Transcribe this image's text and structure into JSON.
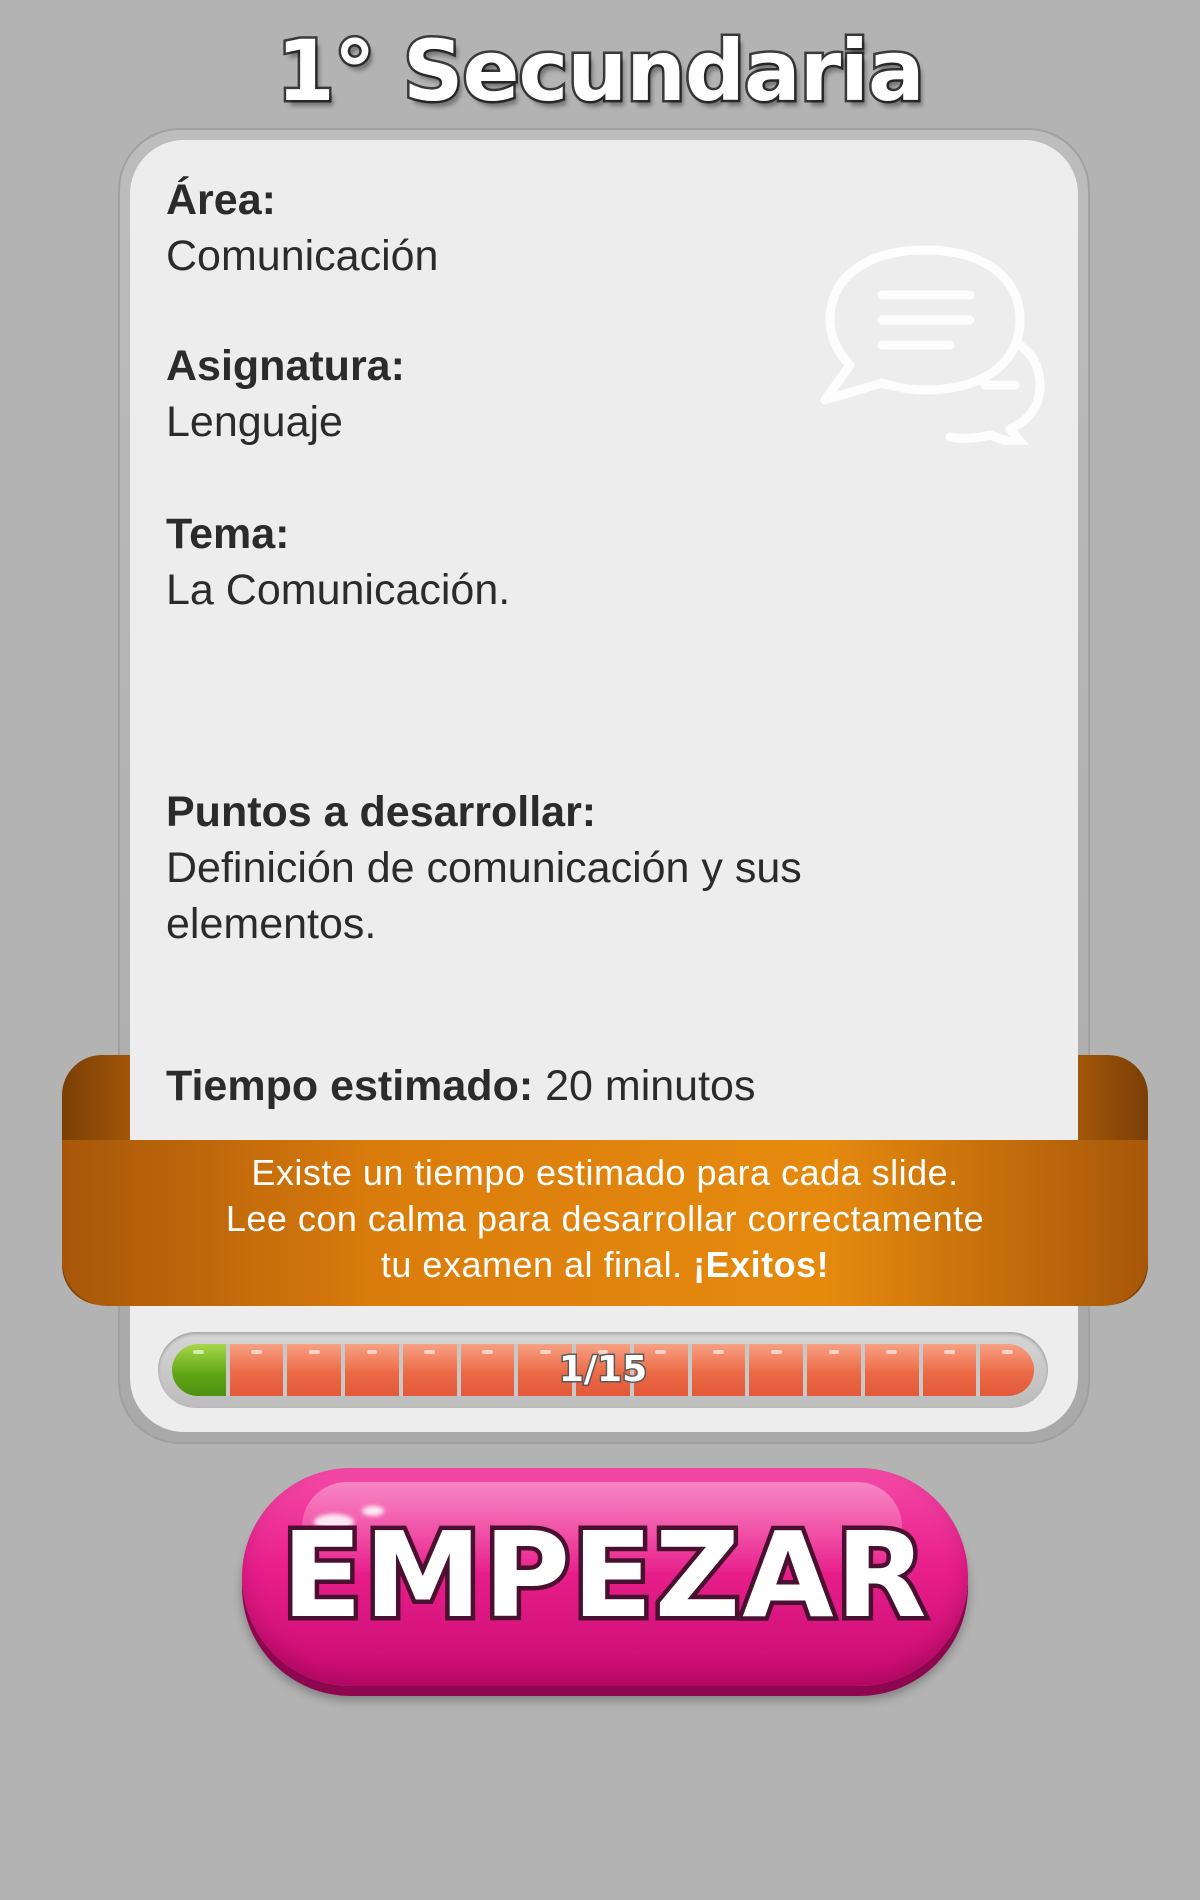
{
  "header": {
    "title": "1° Secundaria"
  },
  "card": {
    "area_label": "Área:",
    "area_value": "Comunicación",
    "subject_label": "Asignatura:",
    "subject_value": "Lenguaje",
    "topic_label": "Tema:",
    "topic_value": "La Comunicación.",
    "points_label": "Puntos a desarrollar:",
    "points_value_line1": "Definición de comunicación y sus",
    "points_value_line2": "elementos.",
    "time_label": "Tiempo estimado:",
    "time_value": " 20 minutos",
    "watermark_icon": "chat-bubbles-icon"
  },
  "ribbon": {
    "line1": "Existe un tiempo estimado para cada slide.",
    "line2": "Lee con calma para desarrollar correctamente",
    "line3_prefix": "tu examen al final. ",
    "line3_bold": "¡Exitos!"
  },
  "progress": {
    "label": "1/15",
    "current": 1,
    "total": 15,
    "done_color": "#5ea414",
    "pending_color": "#ec6a45"
  },
  "start_button": {
    "label": "EMPEZAR",
    "color": "#e91f8c"
  }
}
